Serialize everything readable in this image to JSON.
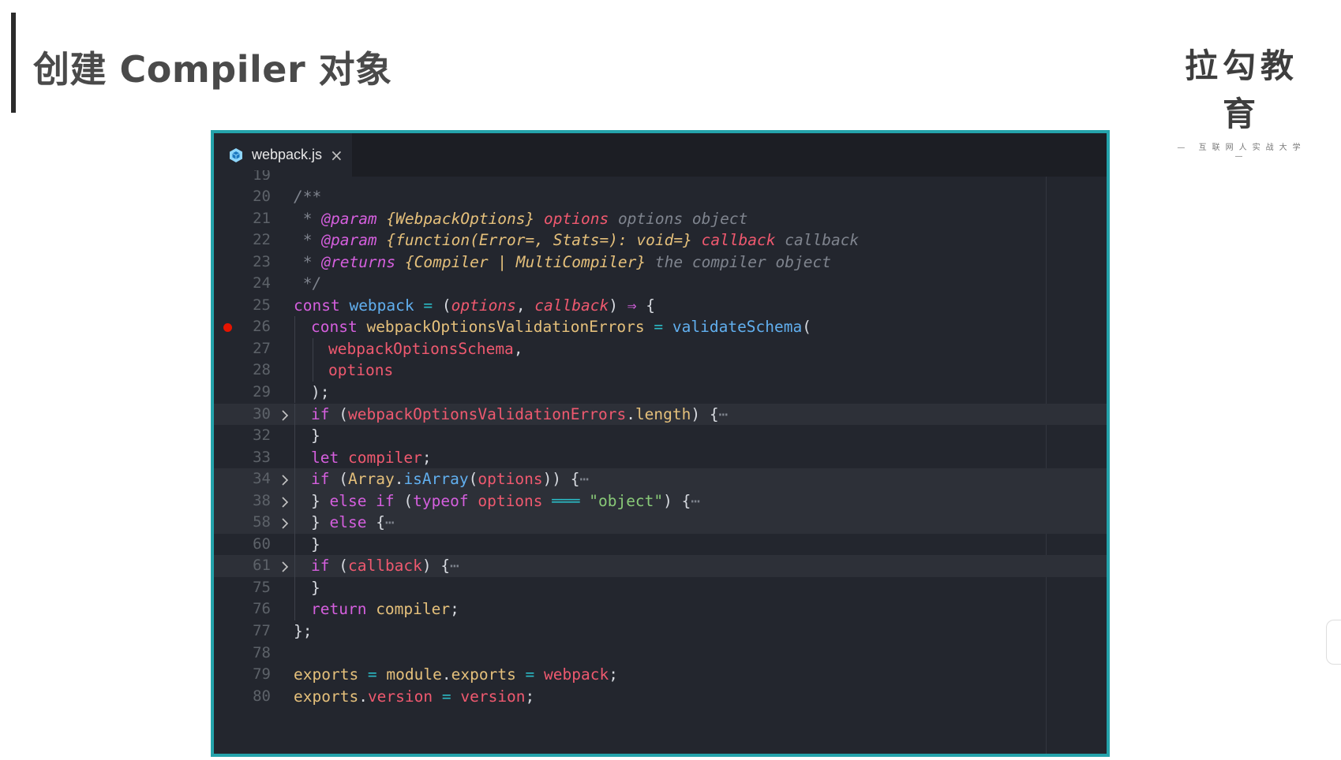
{
  "slide": {
    "title": "创建 Compiler 对象",
    "logo_main": "拉勾教育",
    "logo_sub": "— 互联网人实战大学 —"
  },
  "editor": {
    "tab": {
      "icon": "webpack-cube-icon",
      "label": "webpack.js",
      "close_icon": "close-icon",
      "close_glyph": "×"
    },
    "colors": {
      "keyword": "#d55fde",
      "function": "#61afef",
      "variable": "#ef596f",
      "string": "#89ca78",
      "comment": "#7f848e",
      "type": "#e5c07b",
      "operator": "#2bbac5",
      "default": "#d7dae0",
      "frame_border": "#24a3ab"
    },
    "partial_line_number": "19",
    "lines": [
      {
        "n": "20",
        "indent": 0,
        "hl": false,
        "fold": false,
        "bp": false,
        "tokens": [
          {
            "t": "/**",
            "c": "comment",
            "i": true
          }
        ]
      },
      {
        "n": "21",
        "indent": 0,
        "hl": false,
        "fold": false,
        "bp": false,
        "tokens": [
          {
            "t": " * ",
            "c": "comment",
            "i": true
          },
          {
            "t": "@param",
            "c": "keyword",
            "i": true
          },
          {
            "t": " {WebpackOptions} ",
            "c": "type",
            "i": true
          },
          {
            "t": "options",
            "c": "variable",
            "i": true
          },
          {
            "t": " options object",
            "c": "comment",
            "i": true
          }
        ]
      },
      {
        "n": "22",
        "indent": 0,
        "hl": false,
        "fold": false,
        "bp": false,
        "tokens": [
          {
            "t": " * ",
            "c": "comment",
            "i": true
          },
          {
            "t": "@param",
            "c": "keyword",
            "i": true
          },
          {
            "t": " {function(Error=, Stats=): void=} ",
            "c": "type",
            "i": true
          },
          {
            "t": "callback",
            "c": "variable",
            "i": true
          },
          {
            "t": " callback",
            "c": "comment",
            "i": true
          }
        ]
      },
      {
        "n": "23",
        "indent": 0,
        "hl": false,
        "fold": false,
        "bp": false,
        "tokens": [
          {
            "t": " * ",
            "c": "comment",
            "i": true
          },
          {
            "t": "@returns",
            "c": "keyword",
            "i": true
          },
          {
            "t": " {Compiler | MultiCompiler}",
            "c": "type",
            "i": true
          },
          {
            "t": " the compiler object",
            "c": "comment",
            "i": true
          }
        ]
      },
      {
        "n": "24",
        "indent": 0,
        "hl": false,
        "fold": false,
        "bp": false,
        "tokens": [
          {
            "t": " */",
            "c": "comment",
            "i": true
          }
        ]
      },
      {
        "n": "25",
        "indent": 0,
        "hl": false,
        "fold": false,
        "bp": false,
        "tokens": [
          {
            "t": "const ",
            "c": "keyword"
          },
          {
            "t": "webpack",
            "c": "function"
          },
          {
            "t": " = ",
            "c": "operator"
          },
          {
            "t": "(",
            "c": "default"
          },
          {
            "t": "options",
            "c": "variable",
            "i": true
          },
          {
            "t": ", ",
            "c": "default"
          },
          {
            "t": "callback",
            "c": "variable",
            "i": true
          },
          {
            "t": ") ",
            "c": "default"
          },
          {
            "t": "⇒",
            "c": "keyword"
          },
          {
            "t": " {",
            "c": "default"
          }
        ]
      },
      {
        "n": "26",
        "indent": 1,
        "hl": false,
        "fold": false,
        "bp": true,
        "tokens": [
          {
            "t": "const ",
            "c": "keyword"
          },
          {
            "t": "webpackOptionsValidationErrors",
            "c": "type"
          },
          {
            "t": " = ",
            "c": "operator"
          },
          {
            "t": "validateSchema",
            "c": "function"
          },
          {
            "t": "(",
            "c": "default"
          }
        ]
      },
      {
        "n": "27",
        "indent": 2,
        "hl": false,
        "fold": false,
        "bp": false,
        "tokens": [
          {
            "t": "webpackOptionsSchema",
            "c": "variable"
          },
          {
            "t": ",",
            "c": "default"
          }
        ]
      },
      {
        "n": "28",
        "indent": 2,
        "hl": false,
        "fold": false,
        "bp": false,
        "tokens": [
          {
            "t": "options",
            "c": "variable"
          }
        ]
      },
      {
        "n": "29",
        "indent": 1,
        "hl": false,
        "fold": false,
        "bp": false,
        "tokens": [
          {
            "t": ");",
            "c": "default"
          }
        ]
      },
      {
        "n": "30",
        "indent": 1,
        "hl": true,
        "fold": true,
        "bp": false,
        "tokens": [
          {
            "t": "if ",
            "c": "keyword"
          },
          {
            "t": "(",
            "c": "default"
          },
          {
            "t": "webpackOptionsValidationErrors",
            "c": "variable"
          },
          {
            "t": ".",
            "c": "default"
          },
          {
            "t": "length",
            "c": "type"
          },
          {
            "t": ") {",
            "c": "default"
          },
          {
            "t": "⋯",
            "c": "comment"
          }
        ]
      },
      {
        "n": "32",
        "indent": 1,
        "hl": false,
        "fold": false,
        "bp": false,
        "tokens": [
          {
            "t": "}",
            "c": "default"
          }
        ]
      },
      {
        "n": "33",
        "indent": 1,
        "hl": false,
        "fold": false,
        "bp": false,
        "tokens": [
          {
            "t": "let ",
            "c": "keyword"
          },
          {
            "t": "compiler",
            "c": "variable"
          },
          {
            "t": ";",
            "c": "default"
          }
        ]
      },
      {
        "n": "34",
        "indent": 1,
        "hl": true,
        "fold": true,
        "bp": false,
        "tokens": [
          {
            "t": "if ",
            "c": "keyword"
          },
          {
            "t": "(",
            "c": "default"
          },
          {
            "t": "Array",
            "c": "type"
          },
          {
            "t": ".",
            "c": "default"
          },
          {
            "t": "isArray",
            "c": "function"
          },
          {
            "t": "(",
            "c": "default"
          },
          {
            "t": "options",
            "c": "variable"
          },
          {
            "t": ")) {",
            "c": "default"
          },
          {
            "t": "⋯",
            "c": "comment"
          }
        ]
      },
      {
        "n": "38",
        "indent": 1,
        "hl": true,
        "fold": true,
        "bp": false,
        "tokens": [
          {
            "t": "} ",
            "c": "default"
          },
          {
            "t": "else if ",
            "c": "keyword"
          },
          {
            "t": "(",
            "c": "default"
          },
          {
            "t": "typeof ",
            "c": "keyword"
          },
          {
            "t": "options",
            "c": "variable"
          },
          {
            "t": " ═══ ",
            "c": "operator"
          },
          {
            "t": "\"object\"",
            "c": "string"
          },
          {
            "t": ") {",
            "c": "default"
          },
          {
            "t": "⋯",
            "c": "comment"
          }
        ]
      },
      {
        "n": "58",
        "indent": 1,
        "hl": true,
        "fold": true,
        "bp": false,
        "tokens": [
          {
            "t": "} ",
            "c": "default"
          },
          {
            "t": "else ",
            "c": "keyword"
          },
          {
            "t": "{",
            "c": "default"
          },
          {
            "t": "⋯",
            "c": "comment"
          }
        ]
      },
      {
        "n": "60",
        "indent": 1,
        "hl": false,
        "fold": false,
        "bp": false,
        "tokens": [
          {
            "t": "}",
            "c": "default"
          }
        ]
      },
      {
        "n": "61",
        "indent": 1,
        "hl": true,
        "fold": true,
        "bp": false,
        "tokens": [
          {
            "t": "if ",
            "c": "keyword"
          },
          {
            "t": "(",
            "c": "default"
          },
          {
            "t": "callback",
            "c": "variable"
          },
          {
            "t": ") {",
            "c": "default"
          },
          {
            "t": "⋯",
            "c": "comment"
          }
        ]
      },
      {
        "n": "75",
        "indent": 1,
        "hl": false,
        "fold": false,
        "bp": false,
        "tokens": [
          {
            "t": "}",
            "c": "default"
          }
        ]
      },
      {
        "n": "76",
        "indent": 1,
        "hl": false,
        "fold": false,
        "bp": false,
        "tokens": [
          {
            "t": "return ",
            "c": "keyword"
          },
          {
            "t": "compiler",
            "c": "type"
          },
          {
            "t": ";",
            "c": "default"
          }
        ]
      },
      {
        "n": "77",
        "indent": 0,
        "hl": false,
        "fold": false,
        "bp": false,
        "tokens": [
          {
            "t": "};",
            "c": "default"
          }
        ]
      },
      {
        "n": "78",
        "indent": 0,
        "hl": false,
        "fold": false,
        "bp": false,
        "tokens": []
      },
      {
        "n": "79",
        "indent": 0,
        "hl": false,
        "fold": false,
        "bp": false,
        "tokens": [
          {
            "t": "exports",
            "c": "type"
          },
          {
            "t": " = ",
            "c": "operator"
          },
          {
            "t": "module",
            "c": "type"
          },
          {
            "t": ".",
            "c": "default"
          },
          {
            "t": "exports",
            "c": "type"
          },
          {
            "t": " = ",
            "c": "operator"
          },
          {
            "t": "webpack",
            "c": "variable"
          },
          {
            "t": ";",
            "c": "default"
          }
        ]
      },
      {
        "n": "80",
        "indent": 0,
        "hl": false,
        "fold": false,
        "bp": false,
        "tokens": [
          {
            "t": "exports",
            "c": "type"
          },
          {
            "t": ".",
            "c": "default"
          },
          {
            "t": "version",
            "c": "variable"
          },
          {
            "t": " = ",
            "c": "operator"
          },
          {
            "t": "version",
            "c": "variable"
          },
          {
            "t": ";",
            "c": "default"
          }
        ]
      }
    ]
  }
}
